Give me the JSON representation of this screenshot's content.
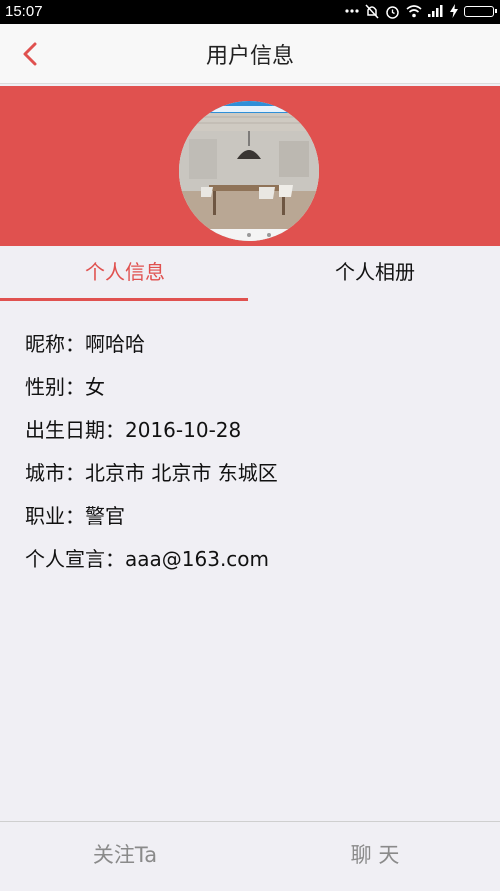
{
  "status_bar": {
    "time": "15:07",
    "icons": [
      "more-dots-icon",
      "alarm-off-icon",
      "alarm-icon",
      "wifi-icon",
      "signal-icon",
      "charging-icon",
      "battery-icon"
    ]
  },
  "header": {
    "title": "用户信息",
    "back_icon": "chevron-left-icon",
    "accent_color": "#e0514f"
  },
  "profile": {
    "avatar_image": "dining-room-photo"
  },
  "tabs": [
    {
      "label": "个人信息",
      "active": true
    },
    {
      "label": "个人相册",
      "active": false
    }
  ],
  "info": [
    {
      "label": "昵称：",
      "value": "啊哈哈"
    },
    {
      "label": "性别：",
      "value": "女"
    },
    {
      "label": "出生日期：",
      "value": "2016-10-28"
    },
    {
      "label": "城市：",
      "value": "北京市 北京市 东城区"
    },
    {
      "label": "职业：",
      "value": "警官"
    },
    {
      "label": "个人宣言：",
      "value": "aaa@163.com"
    }
  ],
  "bottom_bar": {
    "follow_label": "关注Ta",
    "chat_label": "聊 天"
  }
}
